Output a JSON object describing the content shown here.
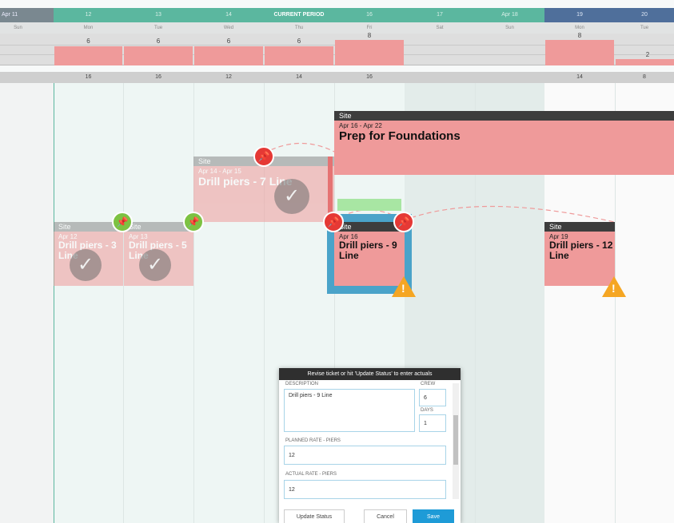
{
  "header": {
    "left_date": "Apr 11",
    "current_period": "CURRENT PERIOD",
    "current_dates": [
      "12",
      "13",
      "14",
      "15",
      "16",
      "17",
      "Apr 18"
    ],
    "future_dates": [
      "19",
      "20"
    ],
    "days": [
      "Sun",
      "Mon",
      "Tue",
      "Wed",
      "Thu",
      "Fri",
      "Sat",
      "Sun",
      "Mon",
      "Tue"
    ],
    "load_values": [
      "6",
      "6",
      "6",
      "6",
      "8",
      "8",
      "2"
    ],
    "totals": [
      "16",
      "16",
      "12",
      "14",
      "16",
      "14",
      "8"
    ]
  },
  "tickets": {
    "foundations": {
      "group": "Site",
      "dates": "Apr 16 - Apr 22",
      "title": "Prep for Foundations"
    },
    "piers7": {
      "group": "Site",
      "dates": "Apr 14 - Apr 15",
      "title": "Drill piers - 7 Line"
    },
    "piers3": {
      "group": "Site",
      "dates": "Apr 12",
      "title": "Drill piers - 3 Line"
    },
    "piers5": {
      "group": "Site",
      "dates": "Apr 13",
      "title": "Drill piers - 5 Line"
    },
    "piers9": {
      "group": "Site",
      "dates": "Apr 16",
      "title": "Drill piers - 9 Line"
    },
    "piers12": {
      "group": "Site",
      "dates": "Apr 19",
      "title": "Drill piers - 12 Line"
    }
  },
  "dialog": {
    "title": "Revise ticket or hit 'Update Status' to enter actuals",
    "description_label": "DESCRIPTION",
    "description_value": "Drill piers - 9 Line",
    "crew_label": "CREW",
    "crew_value": "6",
    "days_label": "DAYS",
    "days_value": "1",
    "planned_label": "PLANNED RATE - PIERS",
    "planned_value": "12",
    "actual_label": "ACTUAL RATE - PIERS",
    "actual_value": "12",
    "update_label": "Update Status",
    "cancel_label": "Cancel",
    "save_label": "Save"
  },
  "icons": {
    "pin": "pin-icon",
    "check": "check-icon",
    "warning": "warning-icon"
  },
  "colors": {
    "current": "#5bb79f",
    "future": "#4f6f9b",
    "ticket": "#ef9a9a",
    "pin_red": "#e53935",
    "pin_green": "#7cc242",
    "warning": "#f5a623",
    "save": "#1e9bd7"
  }
}
